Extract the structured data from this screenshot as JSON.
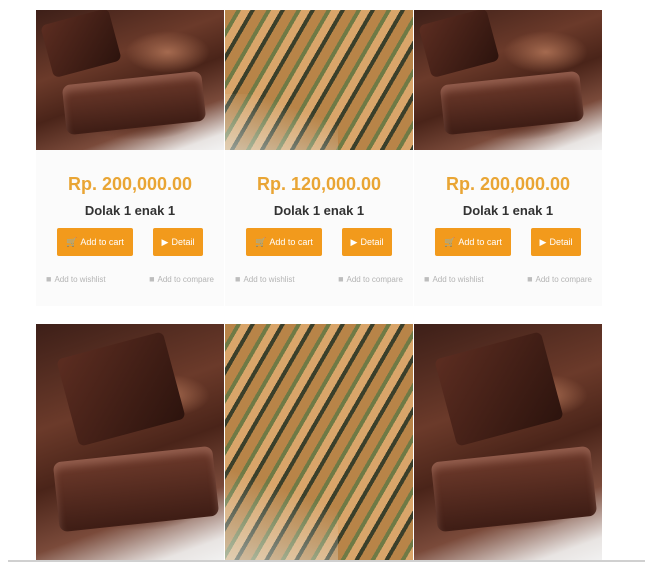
{
  "products": [
    {
      "price": "Rp. 200,000.00",
      "name": "Dolak 1 enak 1",
      "image": "dodol-chocolate-bars",
      "add_to_cart": "Add to cart",
      "detail": "Detail",
      "wishlist": "Add to wishlist",
      "compare": "Add to compare"
    },
    {
      "price": "Rp. 120,000.00",
      "name": "Dolak 1 enak 1",
      "image": "lemang-bamboo-sticks",
      "add_to_cart": "Add to cart",
      "detail": "Detail",
      "wishlist": "Add to wishlist",
      "compare": "Add to compare"
    },
    {
      "price": "Rp. 200,000.00",
      "name": "Dolak 1 enak 1",
      "image": "dodol-chocolate-bars",
      "add_to_cart": "Add to cart",
      "detail": "Detail",
      "wishlist": "Add to wishlist",
      "compare": "Add to compare"
    }
  ],
  "row2_images": [
    "dodol-chocolate-bars",
    "lemang-bamboo-sticks",
    "dodol-chocolate-bars"
  ],
  "colors": {
    "price": "#e9a534",
    "button": "#f29a1c",
    "link": "#b4b4b4"
  },
  "icons": {
    "cart": "cart-icon",
    "detail": "play-icon",
    "wishlist": "heart-icon",
    "compare": "compare-icon"
  }
}
